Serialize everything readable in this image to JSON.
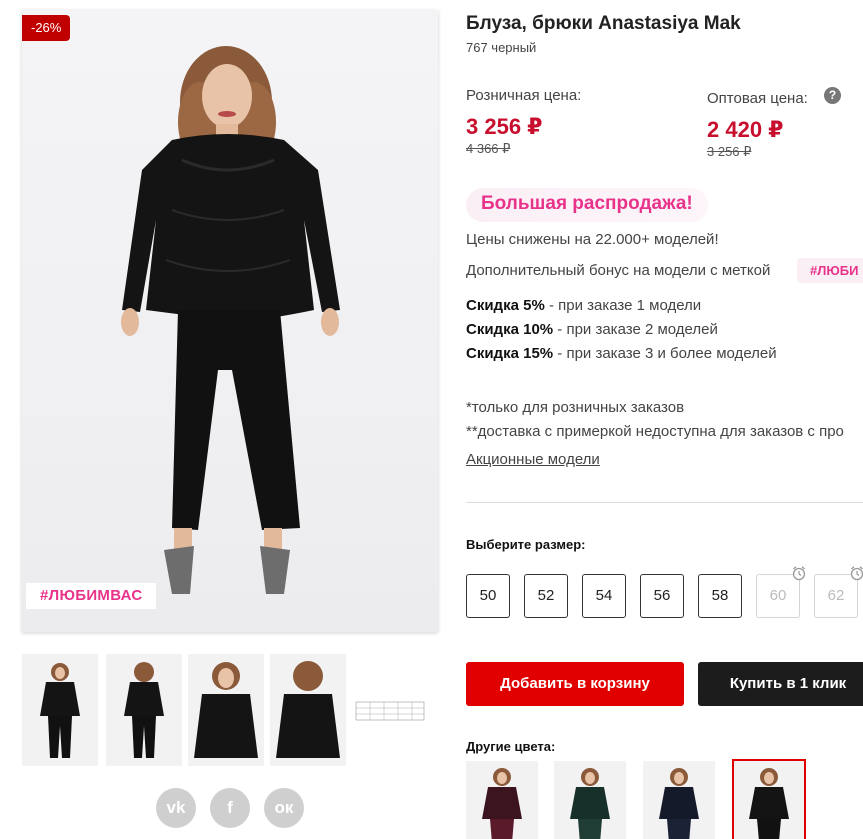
{
  "gallery": {
    "discount_badge": "-26%",
    "hashtag_badge": "#ЛЮБИМВАС",
    "thumbnail_count": 5
  },
  "social": {
    "vk_label": "vk",
    "fb_label": "f",
    "ok_label": "ок"
  },
  "product": {
    "title": "Блуза, брюки Anastasiya Mak",
    "subtitle": "767 черный"
  },
  "pricing": {
    "retail_label": "Розничная цена:",
    "retail_price": "3 256 ₽",
    "retail_old_price": "4 366 ₽",
    "wholesale_label": "Оптовая цена:",
    "wholesale_price": "2 420 ₽",
    "wholesale_old_price": "3 256 ₽",
    "help_glyph": "?"
  },
  "promo": {
    "headline": "Большая распродажа!",
    "line1": "Цены снижены на 22.000+ моделей!",
    "line2": "Дополнительный бонус на модели с меткой",
    "tag": "#ЛЮБИ",
    "discounts": [
      {
        "bold": "Скидка 5%",
        "rest": " - при заказе 1 модели"
      },
      {
        "bold": "Скидка 10%",
        "rest": " - при заказе 2 моделей"
      },
      {
        "bold": "Скидка 15%",
        "rest": " - при заказе 3 и более моделей"
      }
    ],
    "note1": "*только для розничных заказов",
    "note2": "**доставка с примеркой недоступна для заказов с про",
    "link": "Акционные модели"
  },
  "sizes": {
    "title": "Выберите размер:",
    "options": [
      {
        "label": "50",
        "available": true
      },
      {
        "label": "52",
        "available": true
      },
      {
        "label": "54",
        "available": true
      },
      {
        "label": "56",
        "available": true
      },
      {
        "label": "58",
        "available": true
      },
      {
        "label": "60",
        "available": false
      },
      {
        "label": "62",
        "available": false
      }
    ]
  },
  "actions": {
    "add_to_cart": "Добавить в корзину",
    "buy_one_click": "Купить в 1 клик"
  },
  "colors": {
    "title": "Другие цвета:",
    "swatches": [
      {
        "name": "burgundy",
        "color": "#5a1a2a"
      },
      {
        "name": "green",
        "color": "#1f3d34"
      },
      {
        "name": "navy",
        "color": "#1c2236"
      },
      {
        "name": "black",
        "color": "#141414",
        "selected": true
      }
    ]
  },
  "colors_theme": {
    "accent_red": "#e00000",
    "price_red": "#c8102e",
    "pink": "#e8338b",
    "dark_button": "#1c1c1c"
  }
}
